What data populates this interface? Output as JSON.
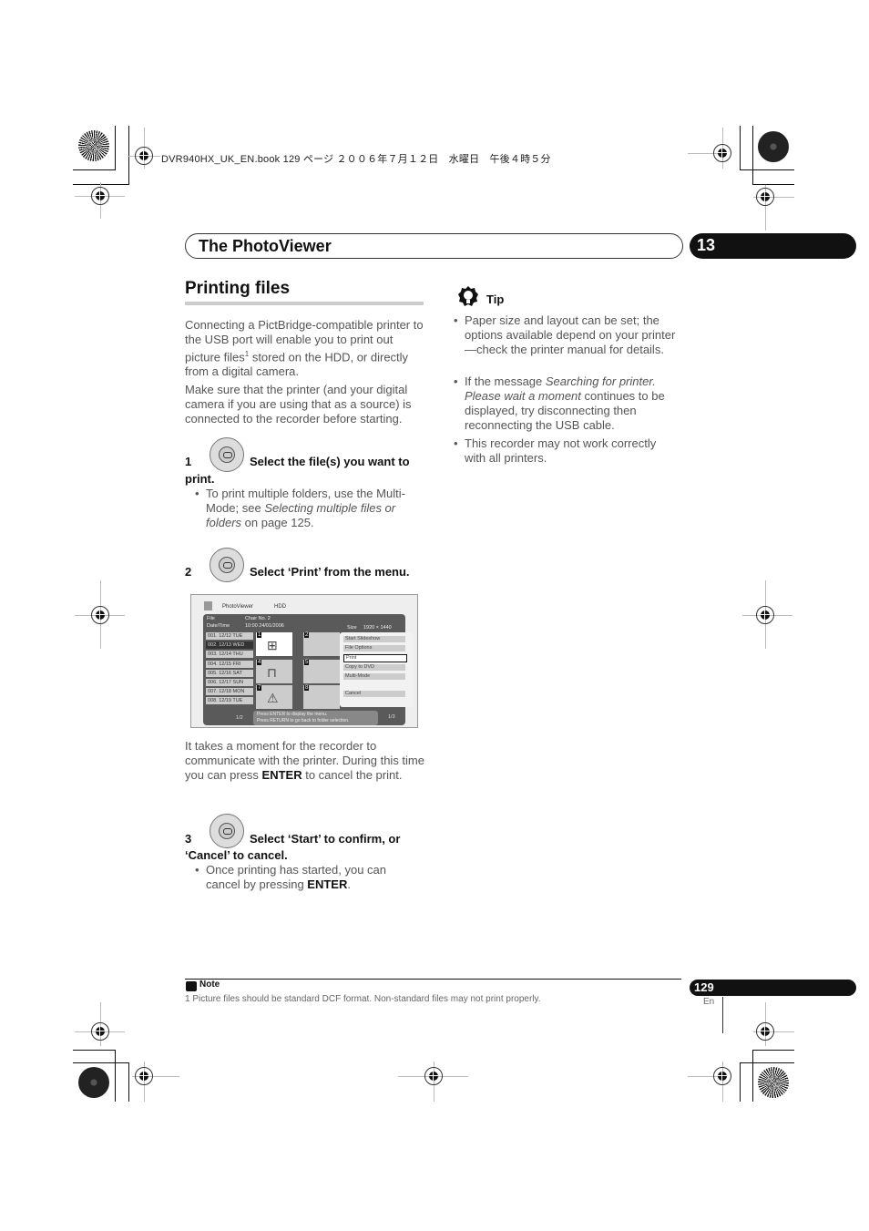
{
  "print_header": "DVR940HX_UK_EN.book  129 ページ  ２００６年７月１２日　水曜日　午後４時５分",
  "chapter": {
    "title": "The PhotoViewer",
    "number": "13"
  },
  "section": {
    "title": "Printing files"
  },
  "intro": {
    "p1_a": "Connecting a PictBridge-compatible printer to the USB port will enable you to print out picture files",
    "p1_sup": "1",
    "p1_b": " stored on the HDD, or directly from a digital camera.",
    "p2": "Make sure that the printer (and your digital camera if you are using that as a source) is connected to the recorder before starting."
  },
  "steps": [
    {
      "number": "1",
      "title_a": "Select the file(s) you want to",
      "title_b": "print.",
      "bullet_a": "To print multiple folders, use the Multi-Mode; see ",
      "bullet_em": "Selecting multiple files or folders",
      "bullet_b": " on page 125."
    },
    {
      "number": "2",
      "title_a": "Select ‘Print’ from the menu."
    },
    {
      "number": "3",
      "title_a": "Select ‘Start’ to confirm, or",
      "title_b": "‘Cancel’ to cancel.",
      "bullet_a": "Once printing has started, you can cancel by pressing ",
      "bullet_strong": "ENTER",
      "bullet_b": "."
    }
  ],
  "after_step2": {
    "a": "It takes a moment for the recorder to communicate with the printer. During this time you can press ",
    "strong": "ENTER",
    "b": " to cancel the print."
  },
  "screen": {
    "app": "PhotoViewer",
    "source": "HDD",
    "file_label": "File",
    "file_value": "Chair No. 2",
    "date_label": "Date/Time",
    "date_value": "10:00  24/01/2006",
    "size_label": "Size",
    "size_value": "1920 × 1440",
    "folders": [
      "001. 12/12 TUE",
      "002. 12/13 WED",
      "003. 12/14 THU",
      "004. 12/15 FRI",
      "005. 12/16 SAT",
      "006. 12/17 SUN",
      "007. 12/18 MON",
      "008. 12/19 TUE"
    ],
    "selected_folder": 1,
    "folder_page": "1/2",
    "thumb_numbers": [
      "1",
      "2",
      "4",
      "5",
      "7",
      "8"
    ],
    "menu": [
      "Start Slideshow",
      "File Options",
      "Print",
      "Copy to DVD",
      "Multi-Mode",
      "Cancel"
    ],
    "menu_selected": "Print",
    "msg1": "Press ENTER to display the menu.",
    "msg2": "Press RETURN to go back to folder selection.",
    "thumb_page": "1/3"
  },
  "tip": {
    "label": "Tip",
    "b1": "Paper size and layout can be set; the options available depend on your printer—check the printer manual for details.",
    "b2_a": "If the message ",
    "b2_em": "Searching for printer. Please wait a moment",
    "b2_b": " continues to be displayed, try disconnecting then reconnecting the USB cable.",
    "b3": "This recorder may not work correctly with all printers."
  },
  "note": {
    "label": "Note",
    "footnote": "1 Picture files should be standard DCF format. Non-standard files may not print properly."
  },
  "page": {
    "number": "129",
    "lang": "En"
  },
  "icons": {
    "dial": "joystick-dial-icon",
    "tip": "lightbulb-icon",
    "note": "pencil-icon"
  }
}
